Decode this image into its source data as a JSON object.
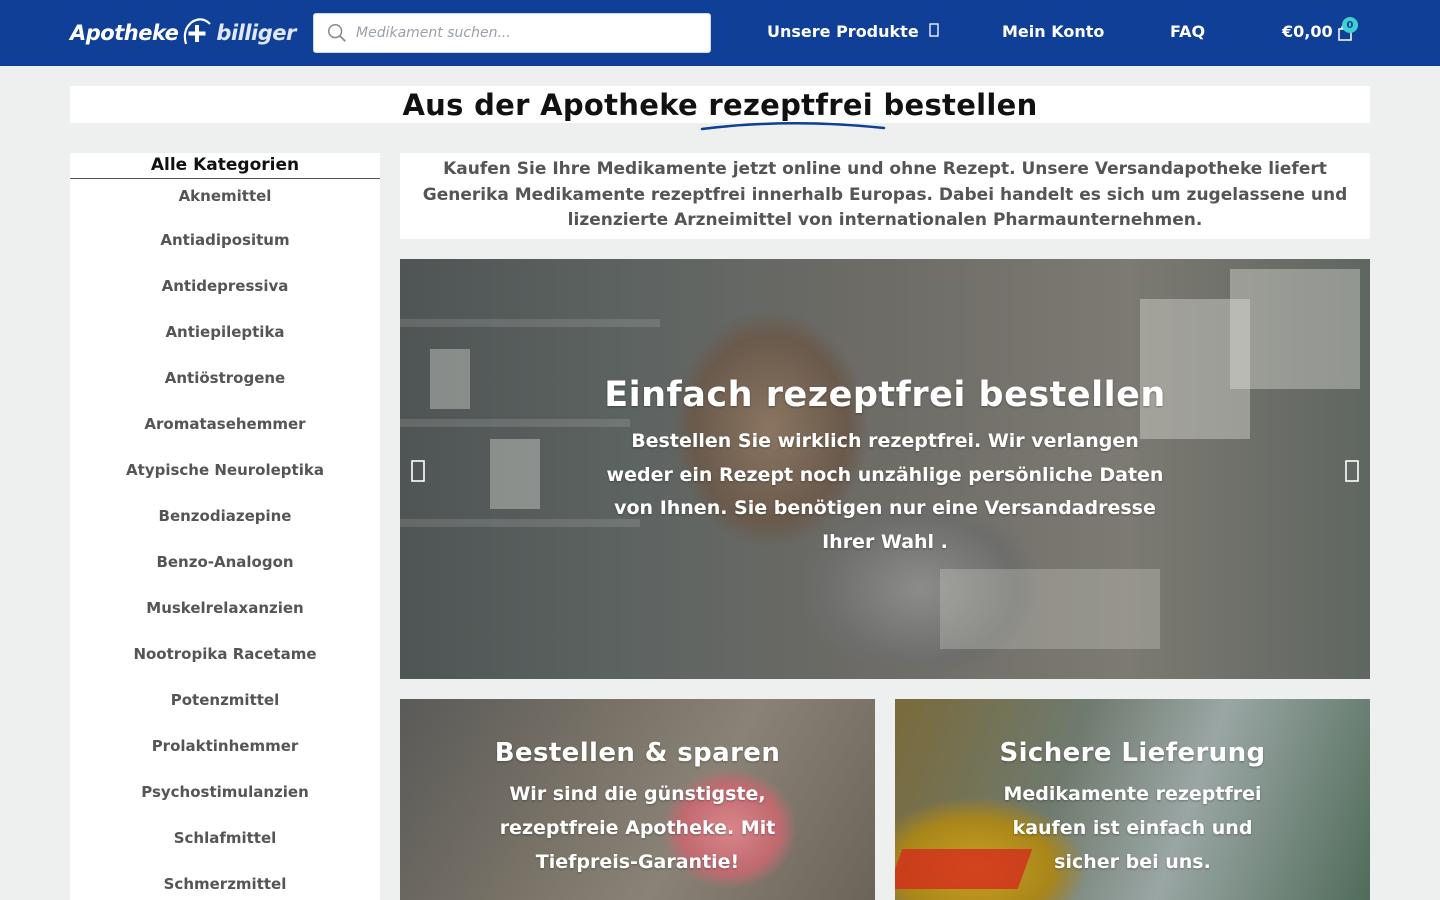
{
  "header": {
    "logo": {
      "part1": "Apotheke",
      "part2": "billiger"
    },
    "search": {
      "placeholder": "Medikament suchen..."
    },
    "nav": {
      "products": "Unsere Produkte",
      "account": "Mein Konto",
      "faq": "FAQ",
      "cart_total": "€0,00",
      "cart_count": "0"
    },
    "colors": {
      "bar": "#0f3f96",
      "badge": "#3fd0d2"
    }
  },
  "title": {
    "text": "Aus der Apotheke rezeptfrei bestellen"
  },
  "sidebar": {
    "heading": "Alle Kategorien",
    "items": [
      "Aknemittel",
      "Antiadipositum",
      "Antidepressiva",
      "Antiepileptika",
      "Antiöstrogene",
      "Aromatasehemmer",
      "Atypische Neuroleptika",
      "Benzodiazepine",
      "Benzo-Analogon",
      "Muskelrelaxanzien",
      "Nootropika Racetame",
      "Potenzmittel",
      "Prolaktinhemmer",
      "Psychostimulanzien",
      "Schlafmittel",
      "Schmerzmittel"
    ]
  },
  "intro": {
    "text": "Kaufen Sie Ihre Medikamente jetzt online und ohne Rezept. Unsere Versandapotheke liefert Generika Medikamente rezeptfrei innerhalb Europas. Dabei handelt es sich um zugelassene und lizenzierte Arzneimittel von internationalen Pharmaunternehmen."
  },
  "slider": {
    "heading": "Einfach rezeptfrei bestellen",
    "text": "Bestellen Sie wirklich rezeptfrei. Wir verlangen weder ein Rezept noch unzählige persönliche Daten von Ihnen. Sie benötigen nur eine Versandadresse Ihrer Wahl .",
    "prev_icon": "chevron-left-icon",
    "next_icon": "chevron-right-icon"
  },
  "cards": [
    {
      "heading": "Bestellen & sparen",
      "text": "Wir sind die günstigste, rezeptfreie Apotheke. Mit Tiefpreis-Garantie!"
    },
    {
      "heading": "Sichere Lieferung",
      "text": "Medikamente rezeptfrei kaufen ist einfach und sicher bei uns."
    }
  ]
}
